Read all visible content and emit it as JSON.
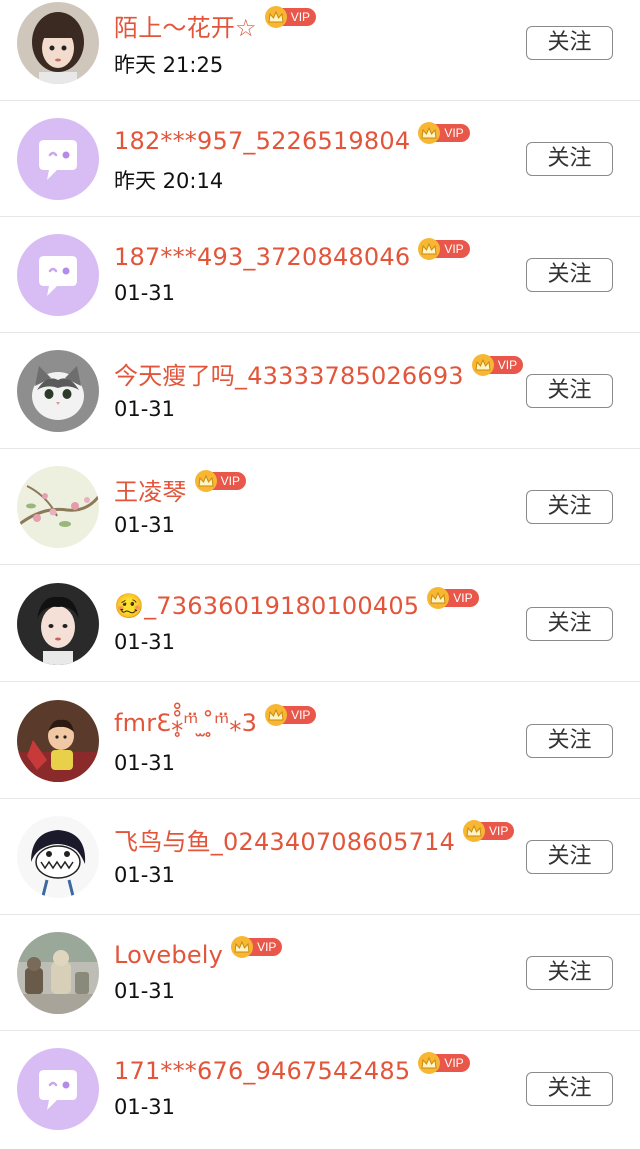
{
  "follow_label": "关注",
  "vip_label": "VIP",
  "colors": {
    "name": "#e2553a",
    "vip_badge": "#e8574a",
    "crown": "#f7b733",
    "default_avatar": "#d8bdf4"
  },
  "rows": [
    {
      "name": "陌上～花开☆",
      "time": "昨天 21:25",
      "avatar": "doll-photo"
    },
    {
      "name": "182***957_5226519804",
      "time": "昨天 20:14",
      "avatar": "default-chat-bubble"
    },
    {
      "name": "187***493_3720848046",
      "time": "01-31",
      "avatar": "default-chat-bubble"
    },
    {
      "name": "今天瘦了吗_43333785026693",
      "time": "01-31",
      "avatar": "cat-photo"
    },
    {
      "name": "王凌琴",
      "time": "01-31",
      "avatar": "blossom-painting"
    },
    {
      "name": "🥴_73636019180100405",
      "time": "01-31",
      "avatar": "girl-photo"
    },
    {
      "name": "fmrƐ⁎̥̊̊ᵐ̈ ̫ ̥̊ᵐ̈⁎3",
      "time": "01-31",
      "avatar": "baby-photo"
    },
    {
      "name": "飞鸟与鱼_024340708605714",
      "time": "01-31",
      "avatar": "cartoon-drawing"
    },
    {
      "name": "Lovebely",
      "time": "01-31",
      "avatar": "toys-photo"
    },
    {
      "name": "171***676_9467542485",
      "time": "01-31",
      "avatar": "default-chat-bubble"
    }
  ]
}
